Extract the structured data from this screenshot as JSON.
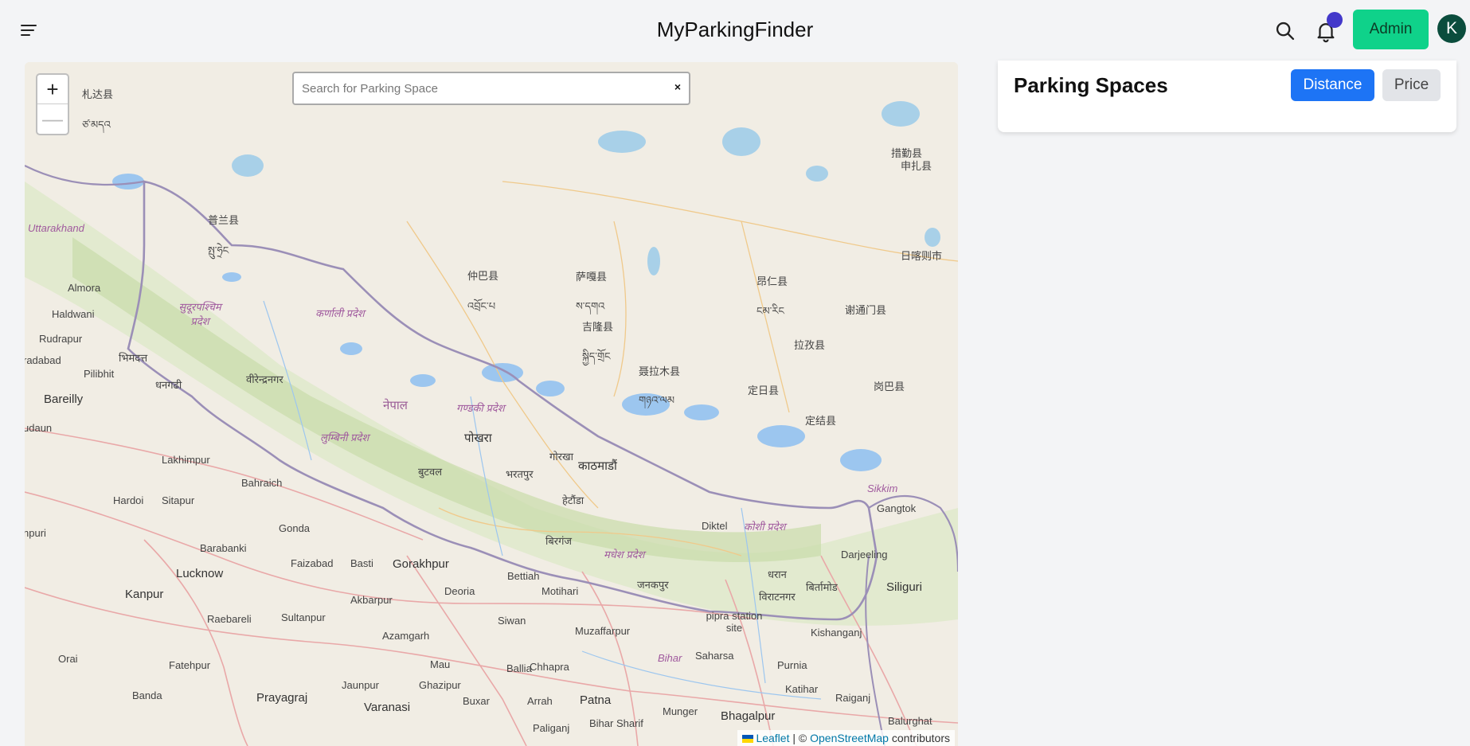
{
  "header": {
    "title": "MyParkingFinder",
    "admin_label": "Admin",
    "avatar_initial": "K"
  },
  "map": {
    "search_placeholder": "Search for Parking Space",
    "search_value": "",
    "clear_label": "×",
    "zoom_in": "+",
    "zoom_out": "—",
    "attribution": {
      "leaflet": "Leaflet",
      "separator": " | © ",
      "osm": "OpenStreetMap",
      "suffix": " contributors"
    },
    "labels": [
      "札达县",
      "ཙ་མདའ",
      "Uttarakhand",
      "普兰县",
      "སྤུ་ཧྲེང",
      "Almora",
      "Haldwani",
      "Rudrapur",
      "radabad",
      "भिमदत्त",
      "Pilibhit",
      "Bareilly",
      "udaun",
      "धनगढी",
      "सुदूरपश्चिम प्रदेश",
      "कर्णाली प्रदेश",
      "वीरेन्द्रनगर",
      "नेपाल",
      "गण्डकी प्रदेश",
      "लुम्बिनी प्रदेश",
      "पोखरा",
      "仲巴县",
      "འབྲོང་པ",
      "萨嘎县",
      "ས་དགའ",
      "吉隆县",
      "སྐྱིད་གྲོང",
      "聂拉木县",
      "གཉའ་ལམ",
      "定日县",
      "昂仁县",
      "ངམ་རིང",
      "谢通门县",
      "拉孜县",
      "定结县",
      "岗巴县",
      "措勤县",
      "日喀则市",
      "申扎县",
      "Lakhimpur",
      "Bahraich",
      "बुटवल",
      "भरतपुर",
      "गोरखा",
      "काठमाडौं",
      "हेटौंडा",
      "Hardoi",
      "Sitapur",
      "Gonda",
      "बिरगंज",
      "Diktel",
      "कोशी प्रदेश",
      "मधेश प्रदेश",
      "Sikkim",
      "Gangtok",
      "Darjeeling",
      "Siliguri",
      "Barabanki",
      "Lucknow",
      "Faizabad",
      "Basti",
      "Gorakhpur",
      "Bettiah",
      "Deoria",
      "Motihari",
      "जनकपुर",
      "धरान",
      "विराटनगर",
      "बिर्तामोड",
      "Kanpur",
      "Raebareli",
      "Sultanpur",
      "Akbarpur",
      "Siwan",
      "Muzaffarpur",
      "pipra station site",
      "Kishanganj",
      "Azamgarh",
      "Saharsa",
      "Purnia",
      "Fatehpur",
      "Mau",
      "Ballia",
      "Chhapra",
      "Bihar",
      "Orai",
      "Jaunpur",
      "Ghazipur",
      "Katihar",
      "Raiganj",
      "Banda",
      "Prayagraj",
      "Varanasi",
      "Buxar",
      "Arrah",
      "Patna",
      "Munger",
      "Bhagalpur",
      "Paliganj",
      "Bihar Sharif",
      "Balurghat",
      "npuri"
    ]
  },
  "panel": {
    "title": "Parking Spaces",
    "distance_label": "Distance",
    "price_label": "Price"
  },
  "colors": {
    "admin_bg": "#0fd28a",
    "distance_bg": "#1d74f5",
    "price_bg": "#e2e4e8",
    "notification_dot": "#4338ca",
    "avatar_bg": "#0b4d3d"
  },
  "icons": [
    "menu-icon",
    "search-icon",
    "bell-icon"
  ]
}
